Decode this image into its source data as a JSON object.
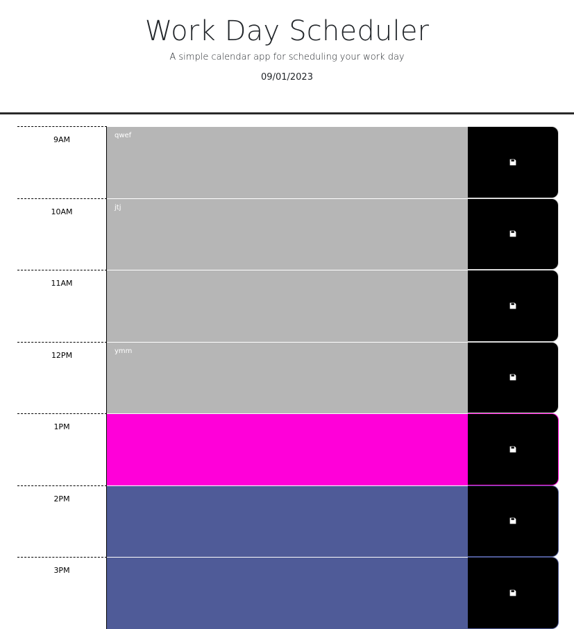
{
  "header": {
    "title": "Work Day Scheduler",
    "subtitle": "A simple calendar app for scheduling your work day",
    "date": "09/01/2023"
  },
  "rows": [
    {
      "hour": "9AM",
      "text": "qwef",
      "state": "past"
    },
    {
      "hour": "10AM",
      "text": "jtj",
      "state": "past"
    },
    {
      "hour": "11AM",
      "text": "",
      "state": "past"
    },
    {
      "hour": "12PM",
      "text": "ymm",
      "state": "past"
    },
    {
      "hour": "1PM",
      "text": "",
      "state": "present"
    },
    {
      "hour": "2PM",
      "text": "",
      "state": "future"
    },
    {
      "hour": "3PM",
      "text": "",
      "state": "future"
    }
  ],
  "colors": {
    "past": "#b6b6b6",
    "present": "#ff00d9",
    "future": "#4f5b98",
    "save_button": "#000000"
  },
  "icons": {
    "save": "save-icon"
  }
}
